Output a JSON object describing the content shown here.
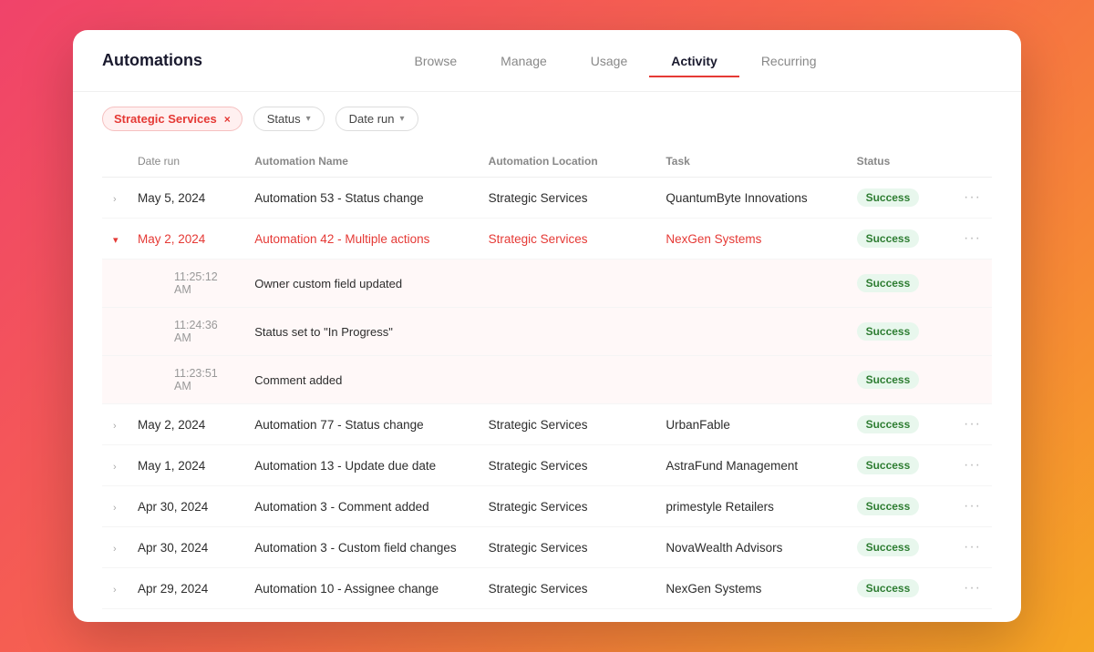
{
  "app": {
    "title": "Automations"
  },
  "nav": {
    "tabs": [
      {
        "label": "Browse",
        "active": false
      },
      {
        "label": "Manage",
        "active": false
      },
      {
        "label": "Usage",
        "active": false
      },
      {
        "label": "Activity",
        "active": true
      },
      {
        "label": "Recurring",
        "active": false
      }
    ]
  },
  "filters": {
    "chip": {
      "label": "Strategic Services",
      "close": "×"
    },
    "dropdowns": [
      {
        "label": "Status",
        "chevron": "▾"
      },
      {
        "label": "Date run",
        "chevron": "▾"
      }
    ]
  },
  "table": {
    "columns": [
      "Date run",
      "Automation Name",
      "Automation Location",
      "Task",
      "Status"
    ],
    "rows": [
      {
        "id": "row1",
        "expanded": false,
        "date": "May 5, 2024",
        "name": "Automation 53 - Status change",
        "location": "Strategic Services",
        "task": "QuantumByte Innovations",
        "status": "Success",
        "subrows": []
      },
      {
        "id": "row2",
        "expanded": true,
        "date": "May 2, 2024",
        "name": "Automation 42 - Multiple actions",
        "location": "Strategic Services",
        "task": "NexGen Systems",
        "status": "Success",
        "subrows": [
          {
            "time": "11:25:12 AM",
            "action": "Owner custom field updated",
            "status": "Success"
          },
          {
            "time": "11:24:36 AM",
            "action": "Status set to \"In Progress\"",
            "status": "Success"
          },
          {
            "time": "11:23:51 AM",
            "action": "Comment added",
            "status": "Success"
          }
        ]
      },
      {
        "id": "row3",
        "expanded": false,
        "date": "May 2, 2024",
        "name": "Automation 77 - Status change",
        "location": "Strategic Services",
        "task": "UrbanFable",
        "status": "Success",
        "subrows": []
      },
      {
        "id": "row4",
        "expanded": false,
        "date": "May 1, 2024",
        "name": "Automation 13 - Update due date",
        "location": "Strategic Services",
        "task": "AstraFund Management",
        "status": "Success",
        "subrows": []
      },
      {
        "id": "row5",
        "expanded": false,
        "date": "Apr 30, 2024",
        "name": "Automation 3 - Comment added",
        "location": "Strategic Services",
        "task": "primestyle Retailers",
        "status": "Success",
        "subrows": []
      },
      {
        "id": "row6",
        "expanded": false,
        "date": "Apr 30, 2024",
        "name": "Automation 3 - Custom field changes",
        "location": "Strategic Services",
        "task": "NovaWealth Advisors",
        "status": "Success",
        "subrows": []
      },
      {
        "id": "row7",
        "expanded": false,
        "date": "Apr 29, 2024",
        "name": "Automation 10 - Assignee change",
        "location": "Strategic Services",
        "task": "NexGen Systems",
        "status": "Success",
        "subrows": []
      }
    ]
  }
}
